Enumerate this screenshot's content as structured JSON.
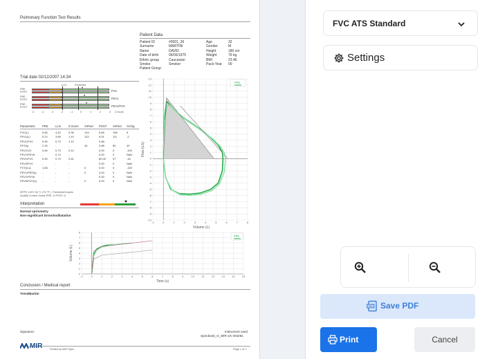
{
  "report": {
    "title": "Pulmonary Function Test Results",
    "patient_data_heading": "Patient Data",
    "patient_fields": [
      {
        "label": "Patient ID",
        "value": "#0001_36"
      },
      {
        "label": "Surname",
        "value": "MARTINI"
      },
      {
        "label": "Name",
        "value": "DAVID"
      },
      {
        "label": "Date of birth",
        "value": "06/05/1975"
      },
      {
        "label": "Ethnic group",
        "value": "Caucasian"
      },
      {
        "label": "Smoke",
        "value": "Smoker"
      },
      {
        "label": "Patient Group",
        "value": ""
      }
    ],
    "patient_fields_right": [
      {
        "label": "Age",
        "value": "32"
      },
      {
        "label": "Gender",
        "value": "M"
      },
      {
        "label": "Height",
        "value": "180 cm"
      },
      {
        "label": "Weight",
        "value": "76 kg"
      },
      {
        "label": "BMI",
        "value": "23.46"
      },
      {
        "label": "Pack-Year",
        "value": "00"
      }
    ],
    "trial_date": "Trial date 02/12/2007 14:34",
    "bar_header_lln": "LLN",
    "bar_header_pred": "Predicted",
    "bar_rows": [
      {
        "pre": "PRE",
        "post": "POST",
        "name": "FVC"
      },
      {
        "pre": "PRE",
        "post": "POST",
        "name": "FEV1"
      },
      {
        "pre": "PRE",
        "post": "POST",
        "name": "FEV1/FVC"
      }
    ],
    "bar_scale": [
      "-5",
      "-4",
      "-3",
      "-2",
      "-1",
      "0",
      "1",
      "2",
      "3"
    ],
    "bar_scale_label": "Z-Score",
    "table_headers": [
      "Parameters",
      "PRE",
      "LLN",
      "Z-Score",
      "%Pred",
      "POST",
      "%Pred",
      "%Chg"
    ],
    "table_rows": [
      [
        "FVC(L)",
        "5.66",
        "4.42",
        "0.35",
        "104",
        "5.89",
        "106",
        "5"
      ],
      [
        "FEV1(L)",
        "5.12",
        "3.66",
        "1.10",
        "113",
        "5.01",
        "111",
        "-2"
      ],
      [
        "FEV1/FVC",
        "0.90",
        "0.73",
        "1.12",
        "",
        "0.88",
        "",
        ""
      ],
      [
        "FET(s)",
        "2.16",
        "-",
        "-",
        "40",
        "3.88",
        "80",
        "40"
      ],
      [
        "FEV1/VC",
        "0.84",
        "0.73",
        "0.10",
        "",
        "0.00",
        "0",
        "-100"
      ],
      [
        "FEV1/FEV6",
        "-",
        "0.74",
        "-",
        "",
        "0.00",
        "0",
        "NaN"
      ],
      [
        "FEV1/FVC",
        "0.90",
        "0.73",
        "2.61",
        "",
        "80.00",
        "97",
        "-16"
      ],
      [
        "FEV3/FVC",
        "-",
        "-",
        "-",
        "",
        "0.00",
        "0",
        "NaN"
      ],
      [
        "FVT(b,s)",
        "1.65",
        "-",
        "-",
        "0",
        "0.00",
        "0",
        "-100"
      ],
      [
        "FEV1/PEF(s)",
        "-",
        "-",
        "-",
        "0",
        "0.00",
        "0",
        "NaN"
      ],
      [
        "FEV1/FEV6",
        "-",
        "-",
        "-",
        "",
        "0.00",
        "0",
        "NaN"
      ],
      [
        "FEV6/FVC(s)",
        "-",
        "-",
        "-",
        "0",
        "0.00",
        "0",
        "NaN"
      ]
    ],
    "table_note_1": "BTPS 1.097 36 °C (76 °F) - Predicted/Graphs",
    "table_note_2": "Quality Control Grade PRE: D POST: D",
    "interpretation_heading": "Interpretation",
    "interpretation_lines": [
      "Normal spirometry",
      "Non-significant bronchodilatation"
    ],
    "flow_legend": "PRE",
    "flow_ylabel": "Flow (L/s)",
    "flow_xlabel": "Volume (L)",
    "flow_yticks": [
      "13",
      "12",
      "11",
      "10",
      "9",
      "8",
      "7",
      "6",
      "5",
      "4",
      "3",
      "2",
      "1",
      "0",
      "-1",
      "-2",
      "-3",
      "-4",
      "-5",
      "-6",
      "-7",
      "-8",
      "-9",
      "-10"
    ],
    "flow_xticks": [
      "-1",
      "0",
      "1",
      "2",
      "3",
      "4",
      "5",
      "6",
      "7",
      "8"
    ],
    "vt_legend": "PRE",
    "vt_ylabel": "Volume (L)",
    "vt_xlabel": "Time (s)",
    "vt_yticks": [
      "8",
      "7",
      "6",
      "5",
      "4",
      "3",
      "2",
      "1",
      "0"
    ],
    "vt_xticks": [
      "-1",
      "0",
      "1",
      "2",
      "3",
      "4",
      "5",
      "6",
      "7",
      "8",
      "9",
      "10",
      "11",
      "12",
      "13",
      "14",
      "15"
    ],
    "conclusion_heading": "Conclusion / Medical report",
    "conclusion_text": "TrendMartini",
    "signature_label": "Signature:",
    "instrument_label": "Instrument used",
    "instrument_value": "Spirobank_G_MIR s/n 003281",
    "logo_text": "MIR",
    "printed_by": "Printed by MIR Spiro",
    "page_number": "Page 1 of 1"
  },
  "chart_data": [
    {
      "type": "line",
      "title": "",
      "xlabel": "Volume (L)",
      "ylabel": "Flow (L/s)",
      "xlim": [
        -1,
        8
      ],
      "ylim": [
        -10,
        13
      ],
      "series": [
        {
          "name": "PRE",
          "color": "#22a84a",
          "x": [
            0,
            0.1,
            0.3,
            0.5,
            0.9,
            1.5,
            2.2,
            3.0,
            3.8,
            4.5,
            5.2,
            5.6,
            5.66,
            5.6,
            5.2,
            4.5,
            3.5,
            2.5,
            1.5,
            0.7,
            0.2,
            0
          ],
          "y": [
            0,
            6.5,
            9.3,
            9.0,
            8.2,
            7.2,
            6.3,
            5.4,
            4.4,
            3.4,
            2.2,
            1.0,
            0,
            -2.0,
            -4.0,
            -5.0,
            -5.6,
            -5.8,
            -5.7,
            -5.0,
            -3.0,
            0
          ]
        },
        {
          "name": "",
          "color": "#8fe3a6",
          "x": [
            0,
            0.1,
            0.35,
            0.6,
            1.0,
            1.6,
            2.3,
            3.1,
            3.9,
            4.7,
            5.4,
            5.8,
            5.89,
            5.8,
            5.3,
            4.6,
            3.6,
            2.6,
            1.6,
            0.8,
            0.2,
            0
          ],
          "y": [
            0,
            6.0,
            8.6,
            8.7,
            8.0,
            7.0,
            6.1,
            5.2,
            4.2,
            3.2,
            2.0,
            0.9,
            0,
            -2.1,
            -4.2,
            -5.2,
            -5.8,
            -6.0,
            -5.9,
            -5.1,
            -3.1,
            0
          ]
        },
        {
          "name": "",
          "color": "#888888",
          "x": [
            0,
            0.3,
            4.8
          ],
          "y": [
            0,
            9.9,
            0
          ]
        },
        {
          "name": "",
          "color": "#888888",
          "x": [
            1.6,
            6.1
          ],
          "y": [
            8.6,
            0
          ]
        }
      ]
    },
    {
      "type": "line",
      "title": "",
      "xlabel": "Time (s)",
      "ylabel": "Volume (L)",
      "xlim": [
        -1,
        15
      ],
      "ylim": [
        0,
        8
      ],
      "series": [
        {
          "name": "PRE",
          "color": "#22a84a",
          "x": [
            0,
            0.2,
            0.5,
            1,
            1.5,
            2.16
          ],
          "y": [
            0,
            3.8,
            4.8,
            5.3,
            5.55,
            5.66
          ]
        },
        {
          "name": "",
          "color": "#8fe3a6",
          "x": [
            0,
            0.2,
            0.5,
            1,
            2,
            3,
            3.88
          ],
          "y": [
            0,
            3.5,
            4.6,
            5.2,
            5.6,
            5.8,
            5.89
          ]
        },
        {
          "name": "",
          "color": "#b04a6a",
          "x": [
            0,
            0.2,
            1,
            6
          ],
          "y": [
            0,
            4.4,
            5.3,
            6.4
          ]
        },
        {
          "name": "",
          "color": "#888888",
          "x": [
            0,
            0.2,
            1,
            6
          ],
          "y": [
            0,
            2.9,
            3.6,
            4.6
          ]
        }
      ]
    }
  ],
  "controls": {
    "standard_select": "FVC ATS Standard",
    "settings_label": "Settings",
    "save_pdf_label": "Save PDF",
    "print_label": "Print",
    "cancel_label": "Cancel"
  }
}
